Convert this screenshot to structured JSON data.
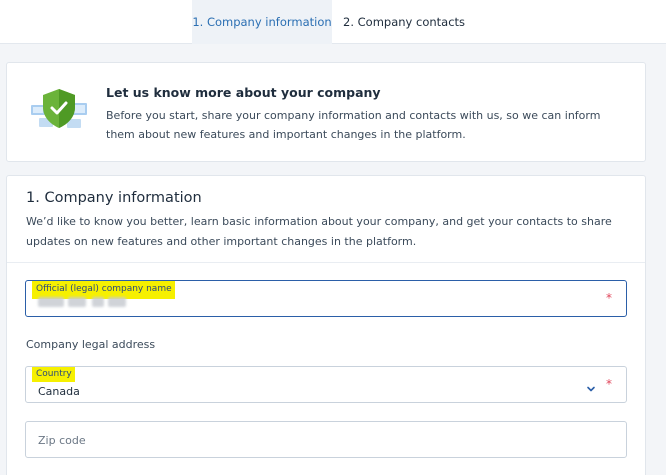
{
  "tabs": [
    {
      "label": "1.  Company information",
      "active": true
    },
    {
      "label": "2.  Company contacts",
      "active": false
    }
  ],
  "intro": {
    "title": "Let us know more about your company",
    "text": "Before you start, share your company information and contacts with us, so we can inform them about new features and important changes in the platform.",
    "icon": "shield-check-icon"
  },
  "form": {
    "title": "1. Company information",
    "description": "We’d like to know you better, learn basic information about your company, and get your contacts to share updates on new features and other important changes in the platform.",
    "company_name": {
      "label": "Official (legal) company name",
      "required_mark": "*"
    },
    "address_label": "Company legal address",
    "country": {
      "label": "Country",
      "value": "Canada",
      "required_mark": "*",
      "icon": "chevron-down-icon"
    },
    "zip": {
      "placeholder": "Zip code"
    }
  },
  "colors": {
    "accent": "#2b6fb3",
    "highlight": "#f6f000",
    "required": "#e0455a",
    "shield": "#5aa02c"
  }
}
